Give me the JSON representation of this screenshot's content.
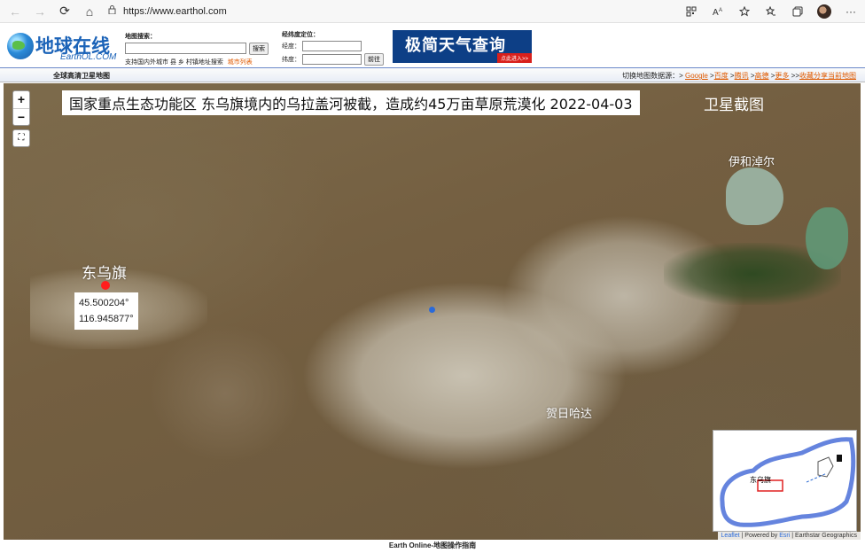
{
  "browser": {
    "url": "https://www.earthol.com",
    "back": "←",
    "forward": "→",
    "reload": "⟳",
    "home": "⌂",
    "lock": "🔒",
    "icons": [
      "qr-icon",
      "read-aloud-icon",
      "favorite-add-icon",
      "favorites-icon",
      "collections-icon",
      "profile-avatar",
      "more-icon"
    ],
    "more": "···"
  },
  "header": {
    "logo_cn": "地球在线",
    "logo_en": "EarthOL.COM",
    "search_label": "地图搜索：",
    "search_button": "搜索",
    "search_hint": "支持国内外城市 县 乡 村镇地址搜索",
    "search_hint_link": "城市列表",
    "coord_label": "经纬度定位：",
    "lng_label": "经度：",
    "lat_label": "纬度：",
    "go_button": "前往",
    "banner_title": "极简天气查询",
    "banner_button": "点此进入>>"
  },
  "subnav": {
    "left": "全球高清卫星地图",
    "right_prefix": "切换地图数据源：>",
    "sources": [
      "Google",
      "百度",
      "腾讯",
      "高德",
      "更多"
    ],
    "share": "收藏分享当前地图"
  },
  "map": {
    "title": "国家重点生态功能区 东乌旗境内的乌拉盖河被截，造成约45万亩草原荒漠化  2022-04-03",
    "title_suffix": "卫星截图",
    "zoom_in": "+",
    "zoom_out": "−",
    "fullscreen": "⛶",
    "places": {
      "dongwu": "东乌旗",
      "yihe": "伊和淖尔",
      "heri": "贺日哈达"
    },
    "coords": {
      "lat": "45.500204°",
      "lng": "116.945877°"
    },
    "inset_label": "东乌旗",
    "attribution": {
      "leaflet": "Leaflet",
      "powered": " | Powered by ",
      "esri": "Esri",
      "rest": " | Earthstar Geographics"
    }
  },
  "footer": {
    "text": "Earth Online-地图操作指南"
  }
}
